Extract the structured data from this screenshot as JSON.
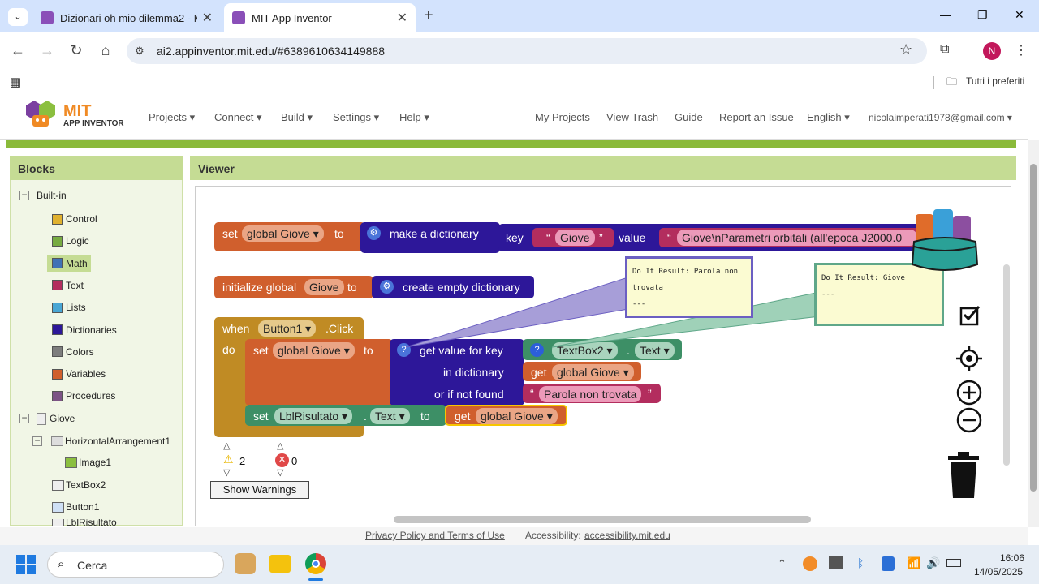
{
  "browser": {
    "tabs": [
      {
        "label": "Dizionari oh mio dilemma2 - M"
      },
      {
        "label": "MIT App Inventor"
      }
    ],
    "new_tab": "+",
    "url": "ai2.appinventor.mit.edu/#6389610634149888",
    "profile_initial": "N",
    "bookmarks_label": "Tutti i preferiti",
    "window": {
      "minimize": "—",
      "maximize": "❐",
      "close": "✕"
    }
  },
  "header": {
    "logo_mit": "MIT",
    "logo_sub": "APP INVENTOR",
    "menus": [
      "Projects ▾",
      "Connect ▾",
      "Build ▾",
      "Settings ▾",
      "Help ▾"
    ],
    "right_links": [
      "My Projects",
      "View Trash",
      "Guide",
      "Report an Issue",
      "English ▾",
      "nicolaimperati1978@gmail.com ▾"
    ]
  },
  "blocks_panel": {
    "title": "Blocks",
    "builtin": "Built-in",
    "builtin_items": [
      {
        "label": "Control",
        "color": "#e0b12f"
      },
      {
        "label": "Logic",
        "color": "#77ab41"
      },
      {
        "label": "Math",
        "color": "#3f71b5"
      },
      {
        "label": "Text",
        "color": "#b32d5e"
      },
      {
        "label": "Lists",
        "color": "#49a6d4"
      },
      {
        "label": "Dictionaries",
        "color": "#2d1799"
      },
      {
        "label": "Colors",
        "color": "#7d7d7d"
      },
      {
        "label": "Variables",
        "color": "#d05f2d"
      },
      {
        "label": "Procedures",
        "color": "#7c5385"
      }
    ],
    "screen": "Giove",
    "components": [
      "HorizontalArrangement1",
      "Image1",
      "TextBox2",
      "Button1",
      "LblRisultato"
    ]
  },
  "viewer": {
    "title": "Viewer",
    "block1": {
      "set": "set",
      "var": "global Giove ▾",
      "to": "to",
      "make": "make a dictionary",
      "key": "key",
      "key_val": "Giove",
      "value": "value",
      "value_text": "Giove\\nParametri orbitali (all'epoca J2000.0"
    },
    "block2": {
      "init": "initialize global",
      "name": "Giove",
      "to": "to",
      "empty": "create empty dictionary"
    },
    "block3": {
      "when": "when",
      "comp": "Button1 ▾",
      "event": ".Click",
      "do": "do",
      "set": "set",
      "var": "global Giove ▾",
      "to": "to",
      "getval": "get value for key",
      "indict": "in dictionary",
      "ifnot": "or if not found",
      "textbox": "TextBox2 ▾",
      "dot": ".",
      "text_prop": "Text ▾",
      "get": "get",
      "getvar": "global Giove ▾",
      "notfound": "Parola non trovata",
      "set2": "set",
      "lbl": "LblRisultato ▾",
      "text_prop2": "Text ▾",
      "to2": "to",
      "get2": "get",
      "getvar2": "global Giove ▾"
    },
    "comment1": {
      "line1": "Do It Result: Parola non",
      "line2": "trovata",
      "line3": "---"
    },
    "comment2": {
      "line1": "Do It Result: Giove",
      "line2": "---"
    },
    "warnings": {
      "count": "2",
      "errors": "0",
      "button": "Show Warnings"
    }
  },
  "footer": {
    "privacy": "Privacy Policy and Terms of Use",
    "access_label": "Accessibility:",
    "access_link": "accessibility.mit.edu"
  },
  "taskbar": {
    "search": "Cerca",
    "time": "16:06",
    "date": "14/05/2025"
  }
}
